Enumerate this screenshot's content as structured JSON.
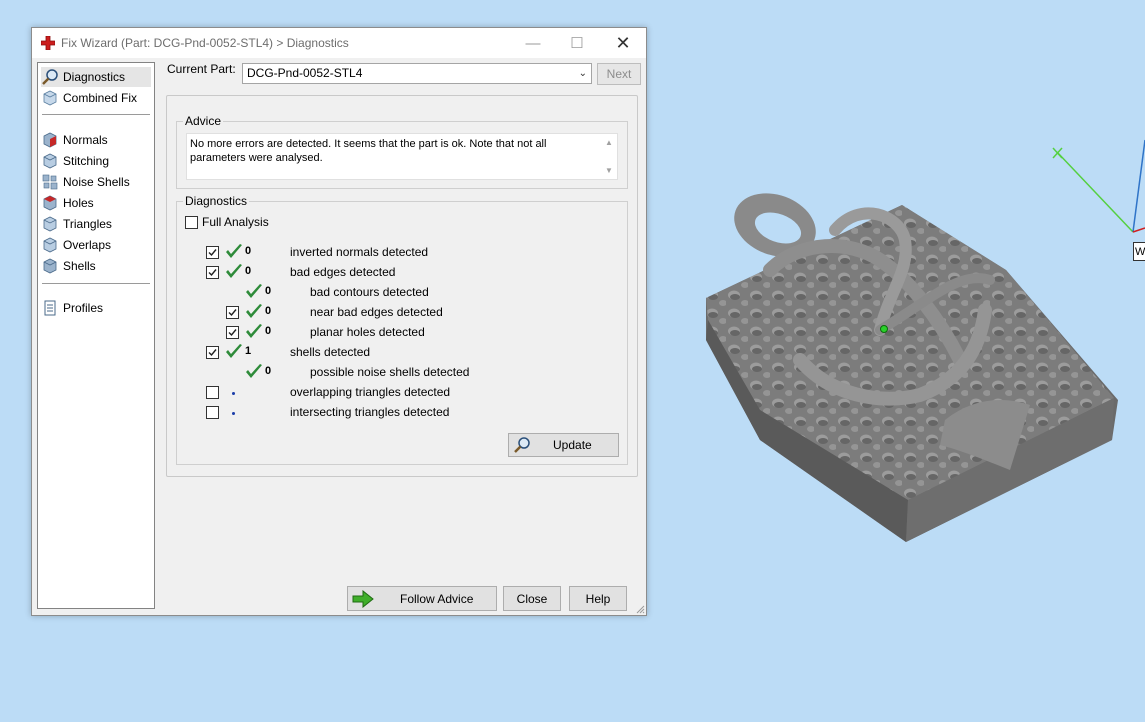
{
  "window": {
    "title": "Fix Wizard (Part: DCG-Pnd-0052-STL4) > Diagnostics",
    "minimize_glyph": "—",
    "maximize_glyph": "☐",
    "close_glyph": "✕"
  },
  "nav": {
    "items": [
      {
        "label": "Diagnostics",
        "icon": "magnifier-icon",
        "selected": true
      },
      {
        "label": "Combined Fix",
        "icon": "cube-icon"
      },
      {
        "label": "Normals",
        "icon": "normals-cube-icon"
      },
      {
        "label": "Stitching",
        "icon": "stitching-cube-icon"
      },
      {
        "label": "Noise Shells",
        "icon": "noise-shells-icon"
      },
      {
        "label": "Holes",
        "icon": "holes-cube-icon"
      },
      {
        "label": "Triangles",
        "icon": "triangles-cube-icon"
      },
      {
        "label": "Overlaps",
        "icon": "overlaps-cube-icon"
      },
      {
        "label": "Shells",
        "icon": "shells-cube-icon"
      },
      {
        "label": "Profiles",
        "icon": "document-icon"
      }
    ]
  },
  "current_part": {
    "label": "Current Part:",
    "value": "DCG-Pnd-0052-STL4",
    "next_label": "Next"
  },
  "advice": {
    "title": "Advice",
    "text": "No more errors are detected. It seems that the part is ok. Note that not all parameters were analysed."
  },
  "diagnostics": {
    "title": "Diagnostics",
    "full_analysis_label": "Full Analysis",
    "full_analysis_checked": false,
    "rows": [
      {
        "checked": true,
        "status": "ok",
        "count": "0",
        "label": "inverted normals detected",
        "indent": 0
      },
      {
        "checked": true,
        "status": "ok",
        "count": "0",
        "label": "bad edges detected",
        "indent": 0
      },
      {
        "checked": null,
        "status": "ok",
        "count": "0",
        "label": "bad contours detected",
        "indent": 1
      },
      {
        "checked": true,
        "status": "ok",
        "count": "0",
        "label": "near bad edges detected",
        "indent": 1
      },
      {
        "checked": true,
        "status": "ok",
        "count": "0",
        "label": "planar holes detected",
        "indent": 1
      },
      {
        "checked": true,
        "status": "ok",
        "count": "1",
        "label": "shells detected",
        "indent": 0
      },
      {
        "checked": null,
        "status": "ok",
        "count": "0",
        "label": "possible noise shells detected",
        "indent": 1
      },
      {
        "checked": false,
        "status": "pending",
        "count": "",
        "label": "overlapping triangles detected",
        "indent": 0
      },
      {
        "checked": false,
        "status": "pending",
        "count": "",
        "label": "intersecting triangles detected",
        "indent": 0
      }
    ],
    "update_label": "Update"
  },
  "footer": {
    "follow_advice_label": "Follow Advice",
    "close_label": "Close",
    "help_label": "Help"
  },
  "viewport": {
    "axis_label": "W",
    "colors": {
      "background": "#bcdcf6",
      "model": "#7a7a7a",
      "x_axis": "#55d040",
      "y_axis": "#2f74c8",
      "z_axis": "#d02020"
    }
  }
}
